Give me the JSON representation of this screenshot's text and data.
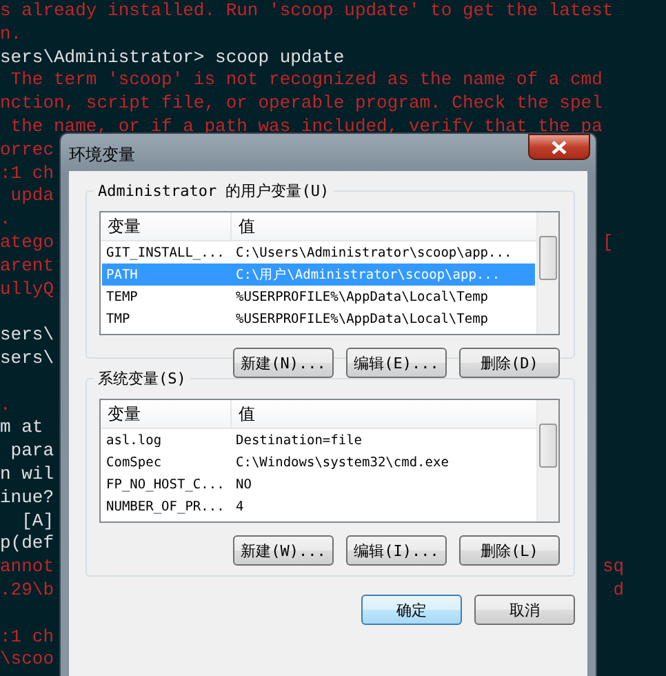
{
  "terminal": {
    "lines": [
      {
        "kind": "error",
        "text": "s already installed. Run 'scoop update' to get the latest"
      },
      {
        "kind": "error",
        "text": "n."
      },
      {
        "kind": "normal",
        "text": "sers\\Administrator> scoop update"
      },
      {
        "kind": "error",
        "text": " The term 'scoop' is not recognized as the name of a cmd"
      },
      {
        "kind": "error",
        "text": "nction, script file, or operable program. Check the spel"
      },
      {
        "kind": "error",
        "text": " the name, or if a path was included, verify that the pa"
      },
      {
        "kind": "error",
        "text": "orrec"
      },
      {
        "kind": "error",
        "text": ":1 ch"
      },
      {
        "kind": "error",
        "text": " upda"
      },
      {
        "kind": "error",
        "text": "."
      },
      {
        "kind": "error",
        "text": "atego",
        "right": "["
      },
      {
        "kind": "error",
        "text": "arent"
      },
      {
        "kind": "error",
        "text": "ullyQ"
      },
      {
        "kind": "blank"
      },
      {
        "kind": "normal",
        "text": "sers\\"
      },
      {
        "kind": "normal",
        "text": "sers\\"
      },
      {
        "kind": "blank"
      },
      {
        "kind": "error",
        "text": "."
      },
      {
        "kind": "normal",
        "text": "m at"
      },
      {
        "kind": "normal",
        "text": " para"
      },
      {
        "kind": "normal",
        "text": "n wil"
      },
      {
        "kind": "normal",
        "text": "inue?"
      },
      {
        "kind": "normal",
        "text": "  [A]"
      },
      {
        "kind": "normal",
        "text": "p(def"
      },
      {
        "kind": "error",
        "text": "annot",
        "right": "sq"
      },
      {
        "kind": "error",
        "text": ".29\\b",
        "right": " d"
      },
      {
        "kind": "blank"
      },
      {
        "kind": "error",
        "text": ":1 ch"
      },
      {
        "kind": "error",
        "text": "\\scoo"
      }
    ]
  },
  "dialog": {
    "title": "环境变量",
    "user_group": {
      "label": "Administrator 的用户变量(U)",
      "columns": [
        "变量",
        "值"
      ],
      "rows": [
        {
          "name": "GIT_INSTALL_...",
          "value": "C:\\Users\\Administrator\\scoop\\app...",
          "selected": false
        },
        {
          "name": "PATH",
          "value": "C:\\用户\\Administrator\\scoop\\app...",
          "selected": true
        },
        {
          "name": "TEMP",
          "value": "%USERPROFILE%\\AppData\\Local\\Temp",
          "selected": false
        },
        {
          "name": "TMP",
          "value": "%USERPROFILE%\\AppData\\Local\\Temp",
          "selected": false
        }
      ],
      "buttons": [
        "新建(N)...",
        "编辑(E)...",
        "删除(D)"
      ]
    },
    "system_group": {
      "label": "系统变量(S)",
      "columns": [
        "变量",
        "值"
      ],
      "rows": [
        {
          "name": "asl.log",
          "value": "Destination=file",
          "selected": false
        },
        {
          "name": "ComSpec",
          "value": "C:\\Windows\\system32\\cmd.exe",
          "selected": false
        },
        {
          "name": "FP_NO_HOST_C...",
          "value": "NO",
          "selected": false
        },
        {
          "name": "NUMBER_OF_PR...",
          "value": "4",
          "selected": false
        }
      ],
      "buttons": [
        "新建(W)...",
        "编辑(I)...",
        "删除(L)"
      ]
    },
    "buttons": [
      "确定",
      "取消"
    ]
  }
}
